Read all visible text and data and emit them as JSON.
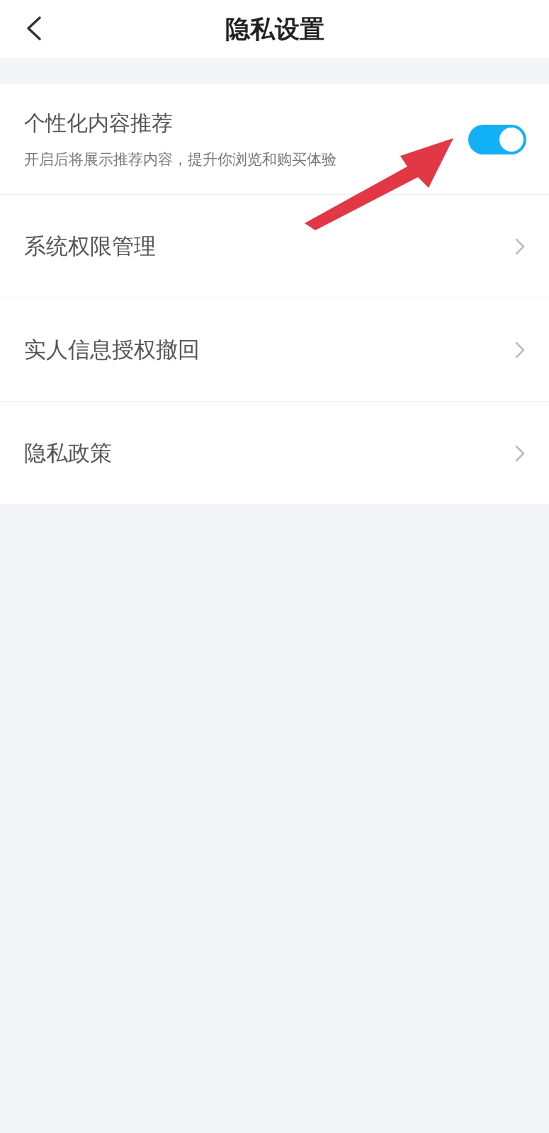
{
  "header": {
    "title": "隐私设置"
  },
  "toggle_item": {
    "label": "个性化内容推荐",
    "description": "开启后将展示推荐内容，提升你浏览和购买体验",
    "on": true
  },
  "menu_items": [
    {
      "label": "系统权限管理"
    },
    {
      "label": "实人信息授权撤回"
    },
    {
      "label": "隐私政策"
    }
  ]
}
